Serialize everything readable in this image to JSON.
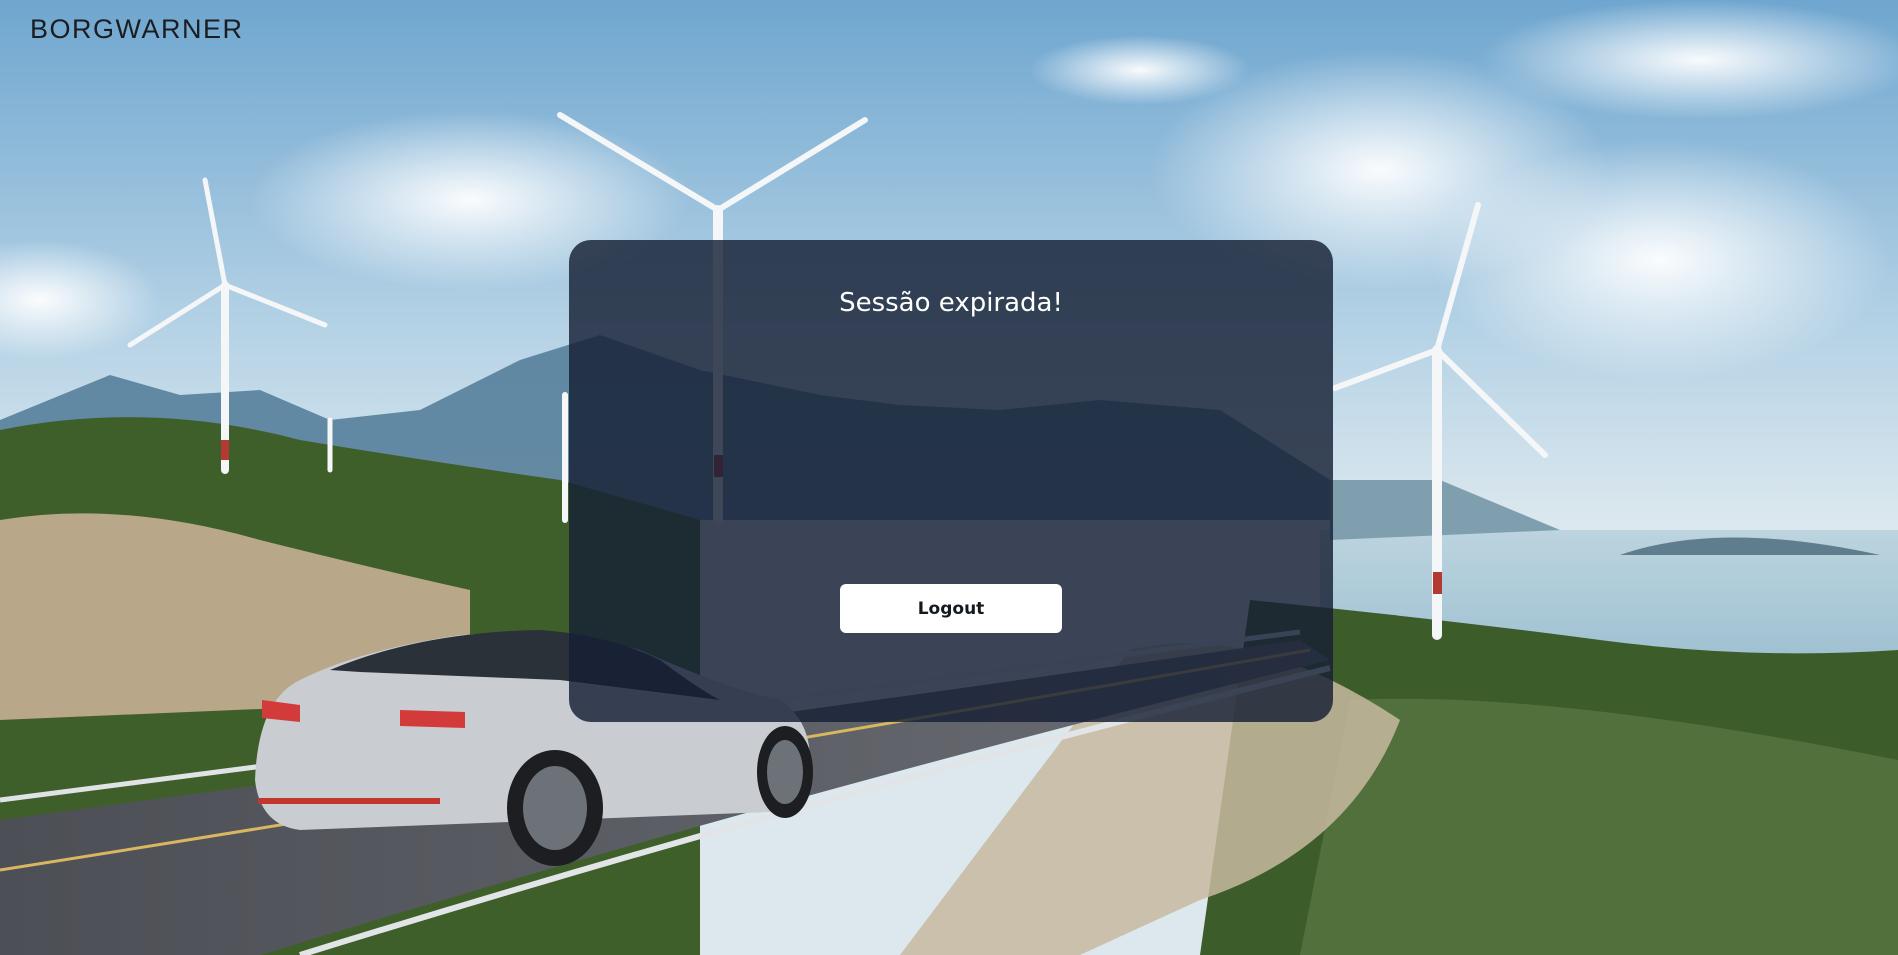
{
  "brand": {
    "logo_text": "BORGWARNER"
  },
  "dialog": {
    "title": "Sessão expirada!",
    "logout_label": "Logout"
  },
  "background": {
    "description_colors": {
      "sky": "#a9cbe2",
      "overlay": "#162034"
    }
  }
}
